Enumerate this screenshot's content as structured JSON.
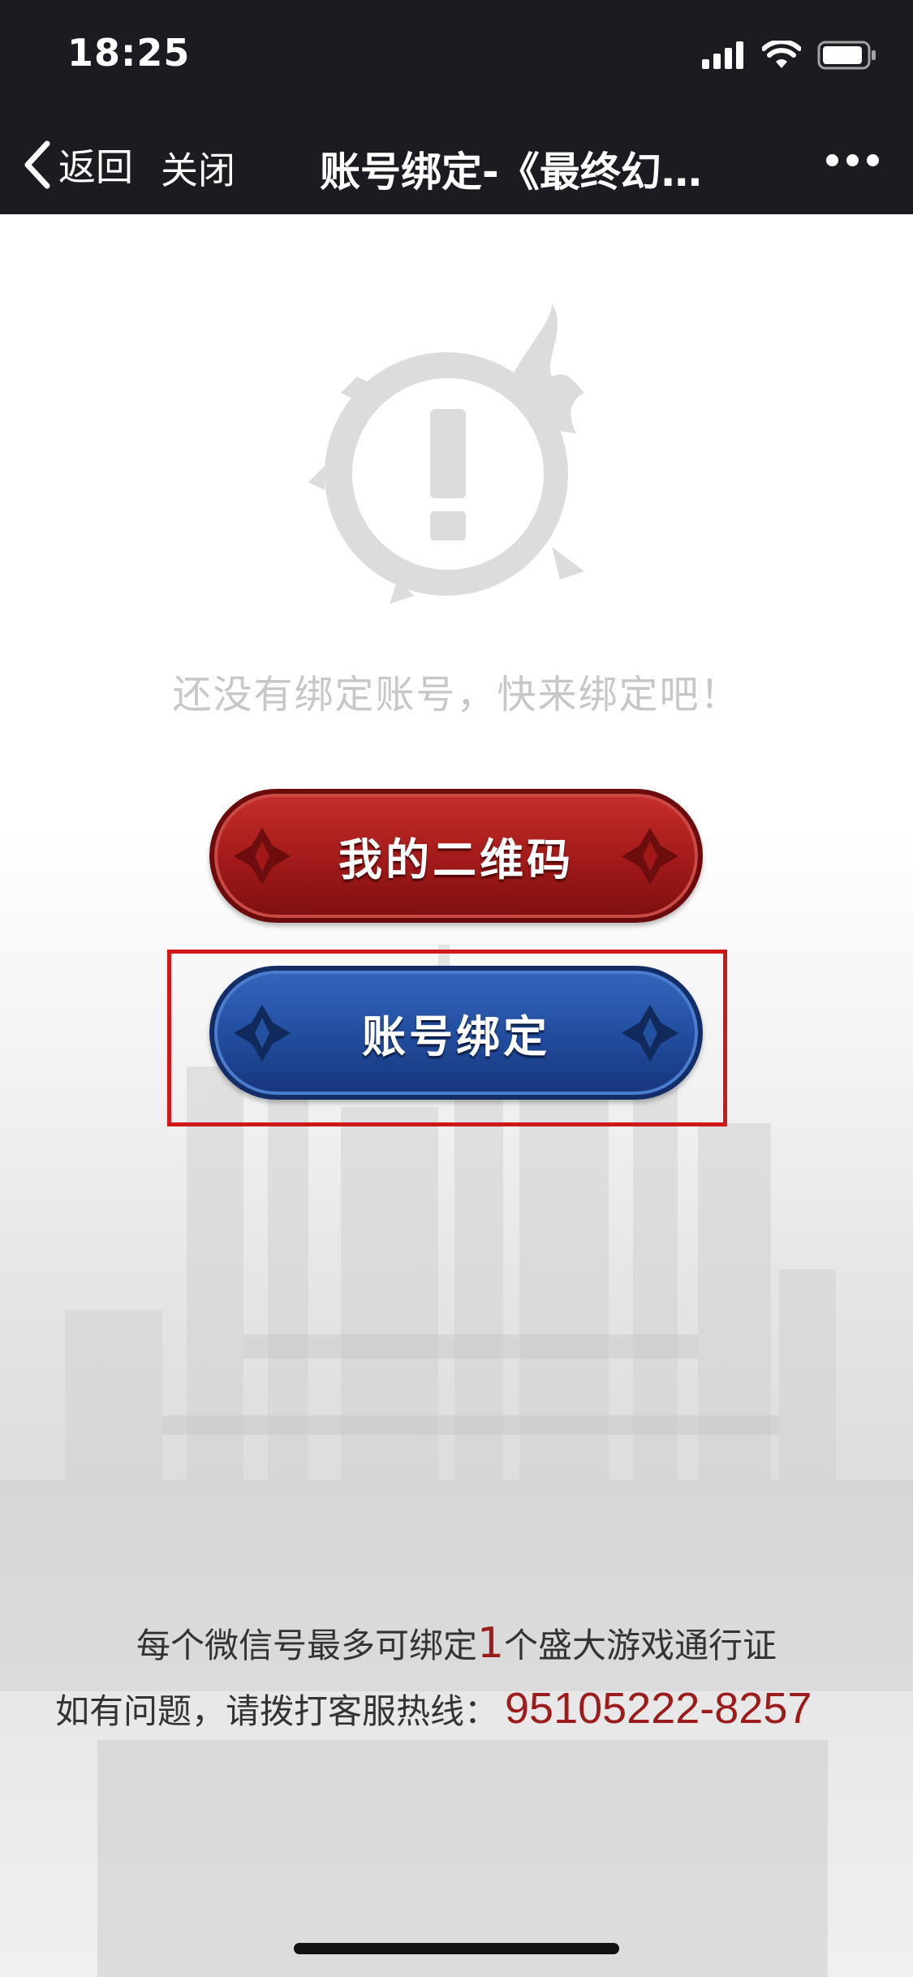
{
  "status_bar": {
    "time": "18:25"
  },
  "nav": {
    "back_label": "返回",
    "close_label": "关闭",
    "title": "账号绑定-《最终幻…"
  },
  "main": {
    "empty_message": "还没有绑定账号，快来绑定吧！",
    "qr_button_label": "我的二维码",
    "bind_button_label": "账号绑定"
  },
  "footer": {
    "limit_prefix": "每个微信号最多可绑定",
    "limit_count": "1",
    "limit_suffix": "个盛大游戏通行证",
    "hotline_prefix": "如有问题，请拨打客服热线：",
    "hotline_number": "95105222-8257"
  },
  "colors": {
    "nav_background": "#1b1b22",
    "qr_button": "#a11a19",
    "bind_button": "#214c9d",
    "highlight": "#d01818",
    "accent_text": "#9c1c1c"
  },
  "icons": [
    "signal-icon",
    "wifi-icon",
    "battery-icon",
    "chevron-left-icon",
    "more-icon",
    "warning-emblem-icon",
    "diamond-ornament-icon"
  ]
}
